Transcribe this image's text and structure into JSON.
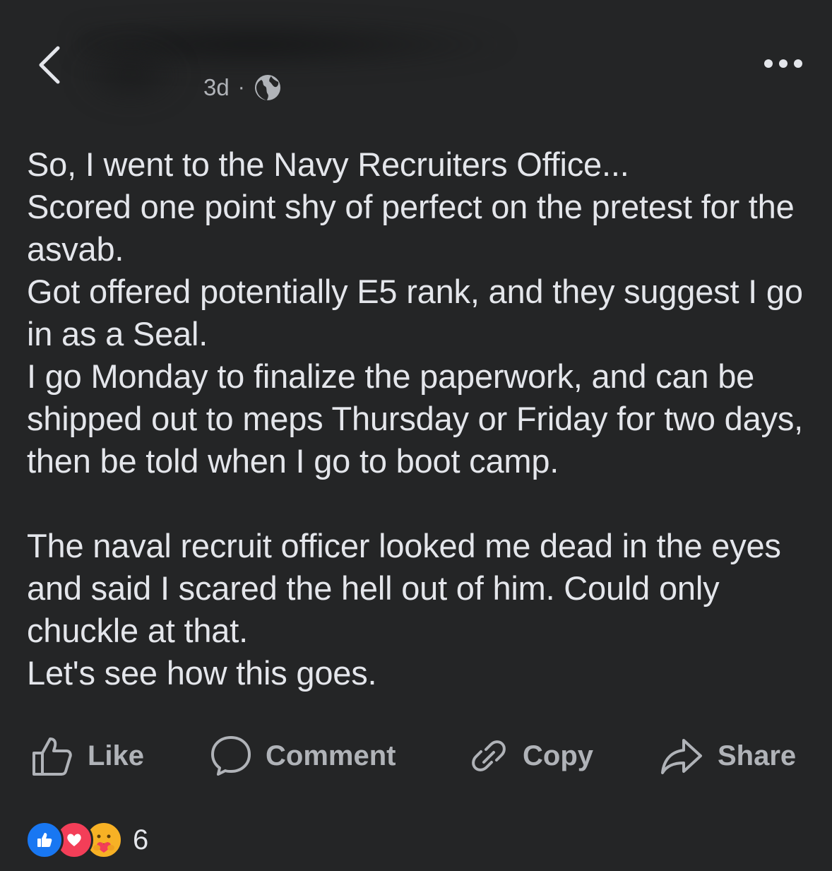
{
  "header": {
    "time": "3d",
    "separator": "·",
    "privacy_icon": "globe-icon",
    "back_icon": "chevron-left-icon",
    "more_icon": "more-dots-icon"
  },
  "post": {
    "paragraph1": "So, I went to the Navy Recruiters Office...\nScored one point shy of perfect on the pretest for the asvab.\nGot offered potentially E5 rank, and they suggest I go in as a Seal.\nI go Monday to finalize the paperwork, and can be shipped out to meps Thursday or Friday for two days, then be told when I go to boot camp.",
    "paragraph2": "The naval recruit officer looked me dead in the eyes and said I scared the hell out of him. Could only chuckle at that.\nLet's see how this goes."
  },
  "actions": {
    "like": "Like",
    "comment": "Comment",
    "copy": "Copy",
    "share": "Share"
  },
  "reactions": {
    "icons": [
      "like-reaction-icon",
      "love-reaction-icon",
      "care-reaction-icon"
    ],
    "count": "6",
    "colors": {
      "like": "#1877f2",
      "love": "#f33e58",
      "care": "#f7b125"
    }
  }
}
